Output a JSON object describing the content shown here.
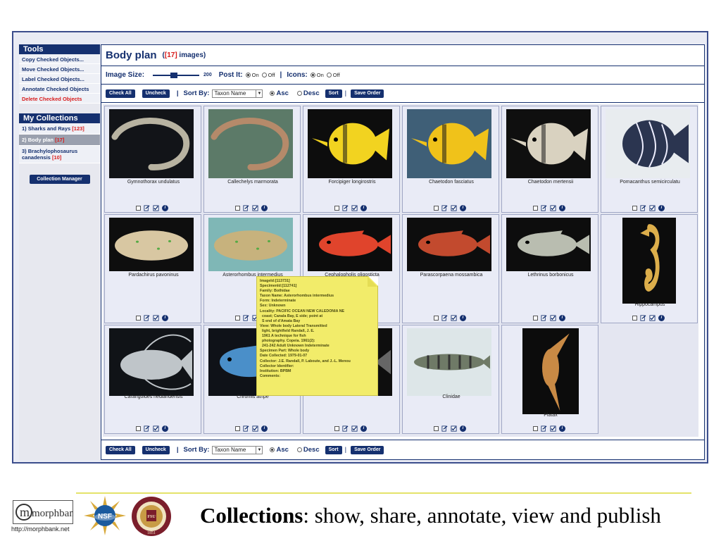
{
  "sidebar": {
    "tools_heading": "Tools",
    "tools": [
      {
        "label": "Copy Checked Objects...",
        "danger": false
      },
      {
        "label": "Move Checked Objects...",
        "danger": false
      },
      {
        "label": "Label Checked Objects...",
        "danger": false
      },
      {
        "label": "Annotate Checked Objects",
        "danger": false
      },
      {
        "label": "Delete Checked Objects",
        "danger": true
      }
    ],
    "collections_heading": "My Collections",
    "collections": [
      {
        "label": "1)  Sharks and Rays ",
        "count": "[123]",
        "selected": false
      },
      {
        "label": "2)  Body plan ",
        "count": "[17]",
        "selected": true
      },
      {
        "label": "3)  Brachylophosaurus canadensis ",
        "count": "[10]",
        "selected": false
      }
    ],
    "manager_button": "Collection Manager"
  },
  "header": {
    "title": "Body plan",
    "subtitle_open": "(",
    "subtitle_count": "[17]",
    "subtitle_close": " images)"
  },
  "options": {
    "image_size_label": "Image Size:",
    "image_size_value": "200",
    "image_size_fraction": 0.45,
    "post_it_label": "Post It:",
    "icons_label": "Icons:",
    "on_label": "On",
    "off_label": "Off"
  },
  "toolbar": {
    "check_all": "Check All",
    "uncheck": "Uncheck",
    "sort_by_label": "Sort By:",
    "sort_field": "Taxon Name",
    "asc": "Asc",
    "desc": "Desc",
    "sort": "Sort",
    "save_order": "Save Order"
  },
  "images": [
    {
      "caption": "Gymnothorax undulatus",
      "bg": "#121418",
      "fg": "#b8b3a1",
      "shape": "eel"
    },
    {
      "caption": "Callechelys marmorata",
      "bg": "#5c7a68",
      "fg": "#b58a6a",
      "shape": "eel"
    },
    {
      "caption": "Forcipiger longirostris",
      "bg": "#0d0d0d",
      "fg": "#f2d320",
      "shape": "butterfly"
    },
    {
      "caption": "Chaetodon fasciatus",
      "bg": "#3f5f77",
      "fg": "#f0c21a",
      "shape": "butterfly"
    },
    {
      "caption": "Chaetodon mertensii",
      "bg": "#0f0f0f",
      "fg": "#d9d2c0",
      "shape": "butterfly"
    },
    {
      "caption": "Pomacanthus semicirculatu",
      "bg": "#e8ecef",
      "fg": "#2b3550",
      "shape": "angel"
    },
    {
      "caption": "Pardachirus pavoninus",
      "bg": "#0e0e0e",
      "fg": "#d8c7a2",
      "shape": "flat"
    },
    {
      "caption": "Asterorhombus intermedius",
      "bg": "#7fb7b6",
      "fg": "#c7b27d",
      "shape": "flat"
    },
    {
      "caption": "Cephalopholis oligosticta",
      "bg": "#0c0c0c",
      "fg": "#e0442c",
      "shape": "fish"
    },
    {
      "caption": "Parascorpaena mossambica",
      "bg": "#0d0d0d",
      "fg": "#c24a2e",
      "shape": "fish"
    },
    {
      "caption": "Lethrinus borbonicus",
      "bg": "#0d0d0d",
      "fg": "#b9bdb0",
      "shape": "fish"
    },
    {
      "caption": "Hippocampus",
      "bg": "#0c0c0c",
      "fg": "#dcae4b",
      "shape": "seahorse"
    },
    {
      "caption": "Carangoides hedlandensis",
      "bg": "#101317",
      "fg": "#bfc5c9",
      "shape": "jack"
    },
    {
      "caption": "Chromis atripe",
      "bg": "#0f1218",
      "fg": "#4a8fc9",
      "shape": "fish"
    },
    {
      "caption": "",
      "bg": "#0e0e0e",
      "fg": "#666666",
      "shape": "fish"
    },
    {
      "caption": "Clinidae",
      "bg": "#dde6e8",
      "fg": "#6f7a67",
      "shape": "slim"
    },
    {
      "caption": "Platax",
      "bg": "#0c0c0c",
      "fg": "#c98a45",
      "shape": "platax"
    }
  ],
  "tooltip_lines": [
    "ImageId:[113731]",
    "SpecimenId:[112741]",
    "Family: Bothidae",
    "Taxon Name: Asterorhombus intermedius",
    "Form: Indeterminate",
    "Sex: Unknown",
    "Locality: PACIFIC OCEAN NEW CALEDONIA NE\n  coast; Canala Bay, E side; point at\n  S end of d'Amata Bay",
    "View: Whole body Lateral Transmitted\n  light, brightfield Randall, J. E.\n  1961 A technique for fish\n  photography. Copeia. 1961(2):\n  241-242 Adult Unknown Indeterminate",
    "Specimen Part: Whole body",
    "Date Collected: 1979-01-07",
    "Collector: J.E. Randall, P. Laboute, and J.-L. Menou",
    "Collector Identifier:",
    "Institution: BPBM",
    "Comments:"
  ],
  "footer": {
    "logo_text": "morphbank",
    "logo_url": "http://morphbank.net",
    "nsf_text": "NSF",
    "fsu_text": "FSU",
    "fsu_year": "1851",
    "caption_bold": "Collections",
    "caption_rest": ": show, share, annotate, view and publish"
  },
  "colors": {
    "brand_navy": "#15306f",
    "alert_red": "#d81b1b",
    "postit_yellow": "#f2ec6a"
  }
}
